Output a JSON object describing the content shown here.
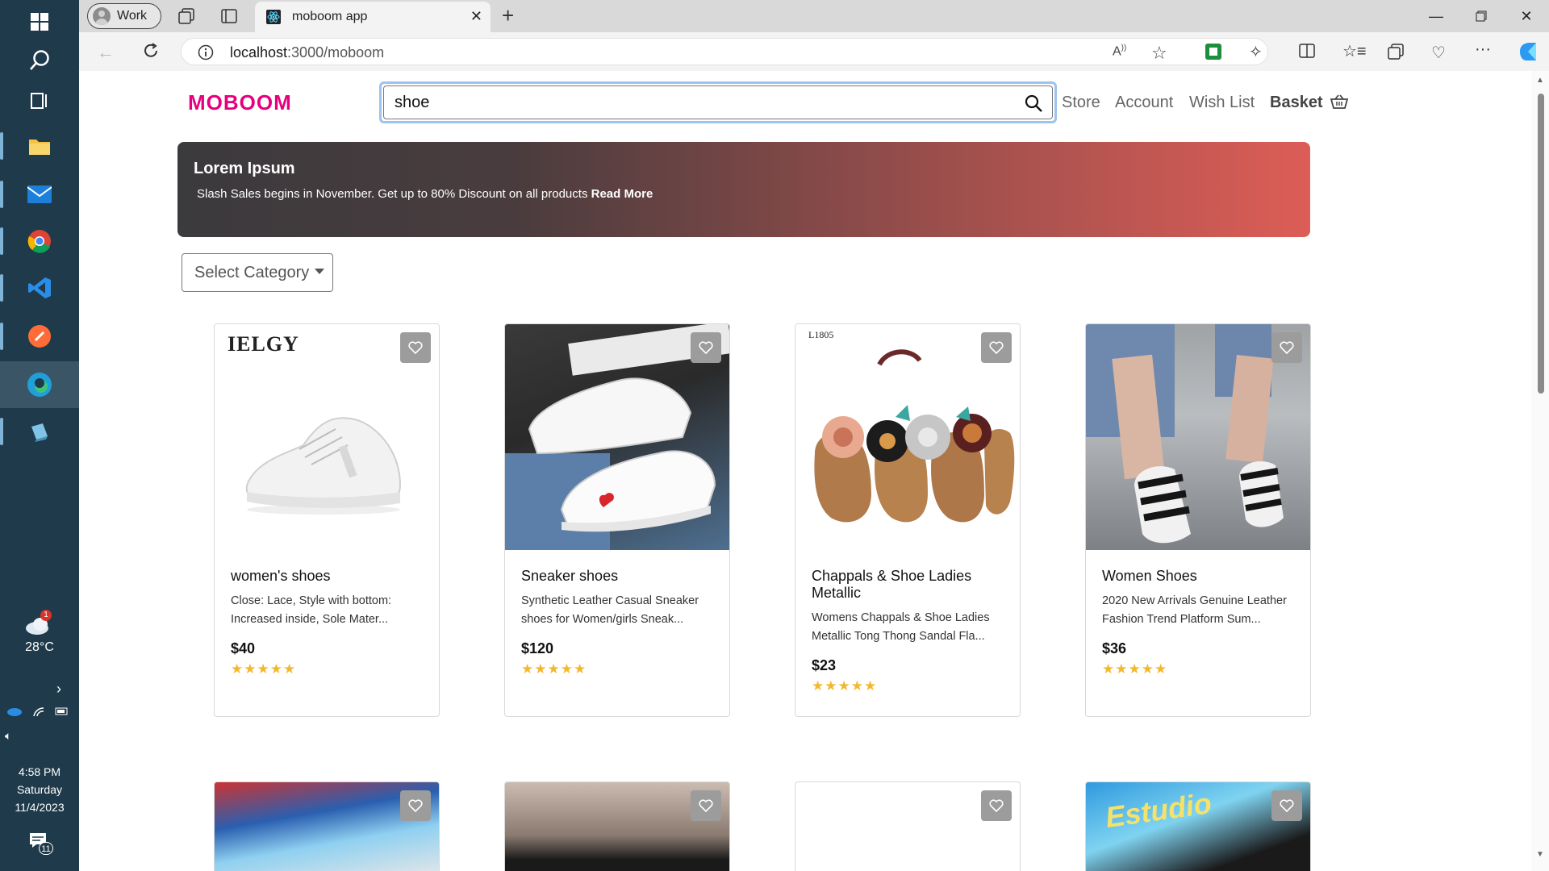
{
  "taskbar": {
    "weather_temp": "28°C",
    "weather_badge": "1",
    "time": "4:58 PM",
    "day": "Saturday",
    "date": "11/4/2023",
    "notification_count": "11"
  },
  "browser": {
    "profile_label": "Work",
    "tab_title": "moboom app",
    "url_host": "localhost",
    "url_path": ":3000/moboom"
  },
  "header": {
    "logo": "MOBOOM",
    "search_value": "shoe",
    "nav": [
      "Store",
      "Account",
      "Wish List"
    ],
    "basket_label": "Basket"
  },
  "banner": {
    "title": "Lorem Ipsum",
    "text": "Slash Sales begins in November. Get up to 80% Discount on all products",
    "link": "Read More"
  },
  "filter": {
    "select_label": "Select Category"
  },
  "products": [
    {
      "title": "women's shoes",
      "desc": "Close: Lace, Style with bottom: Increased inside, Sole Mater...",
      "price": "$40",
      "rating": 5,
      "brand": "IELGY"
    },
    {
      "title": "Sneaker shoes",
      "desc": "Synthetic Leather Casual Sneaker shoes for Women/girls Sneak...",
      "price": "$120",
      "rating": 5
    },
    {
      "title": "Chappals & Shoe Ladies Metallic",
      "desc": "Womens Chappals & Shoe Ladies Metallic Tong Thong Sandal Fla...",
      "price": "$23",
      "rating": 5,
      "brand": "L1805"
    },
    {
      "title": "Women Shoes",
      "desc": "2020 New Arrivals Genuine Leather Fashion Trend Platform Sum...",
      "price": "$36",
      "rating": 5
    }
  ],
  "second_row_brand": "Estudio",
  "stars_text": "★★★★★"
}
